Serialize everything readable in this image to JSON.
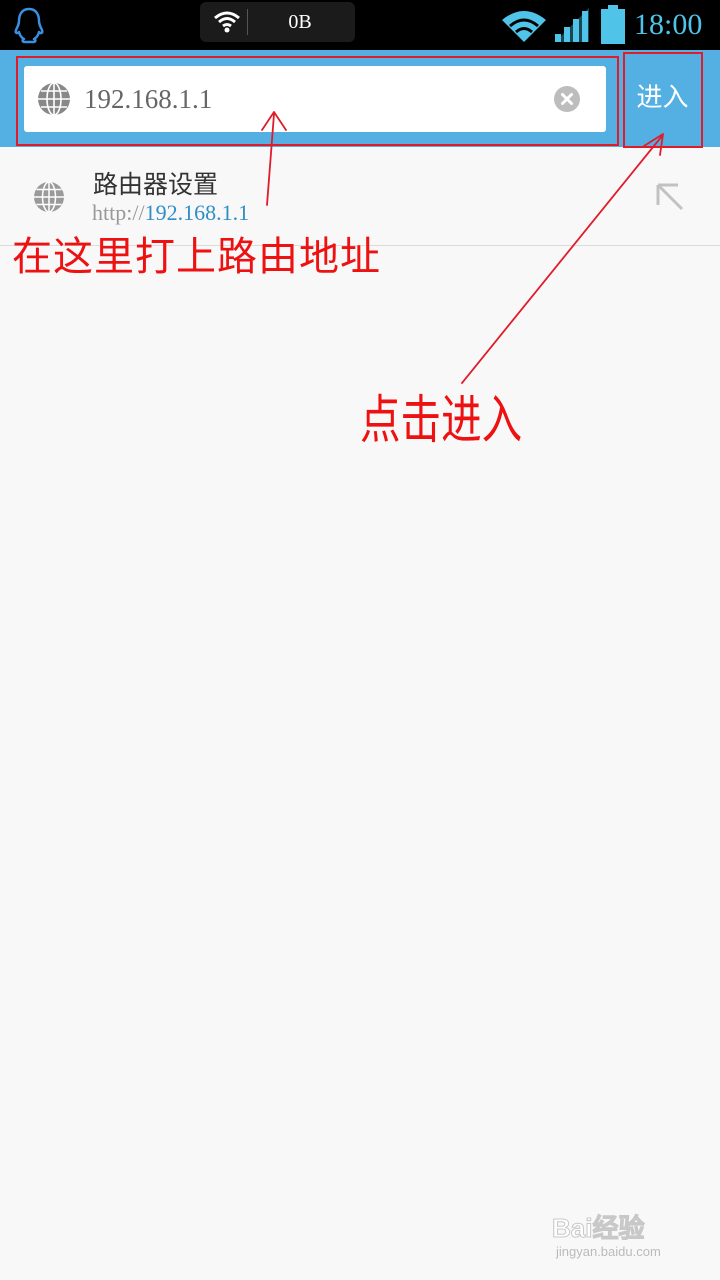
{
  "status_bar": {
    "traffic": "0B",
    "time": "18:00",
    "icons": [
      "qq-icon",
      "wifi-icon",
      "signal-icon",
      "battery-icon"
    ]
  },
  "address_bar": {
    "url_value": "192.168.1.1",
    "enter_label": "进入",
    "icons": [
      "globe-icon",
      "clear-icon"
    ]
  },
  "suggestion": {
    "title": "路由器设置",
    "url_protocol": "http://",
    "url_host": "192.168.1.1",
    "icons": [
      "globe-icon",
      "fill-arrow-icon"
    ]
  },
  "annotations": {
    "input_hint": "在这里打上路由地址",
    "enter_hint": "点击进入",
    "color": "#e01c2b"
  },
  "watermark": {
    "brand": "Bai经验",
    "site": "jingyan.baidu.com"
  },
  "colors": {
    "accent": "#54b0e2",
    "status_bar": "#000000",
    "time_color": "#4fc3e8",
    "url_host_color": "#2e8fc7"
  }
}
